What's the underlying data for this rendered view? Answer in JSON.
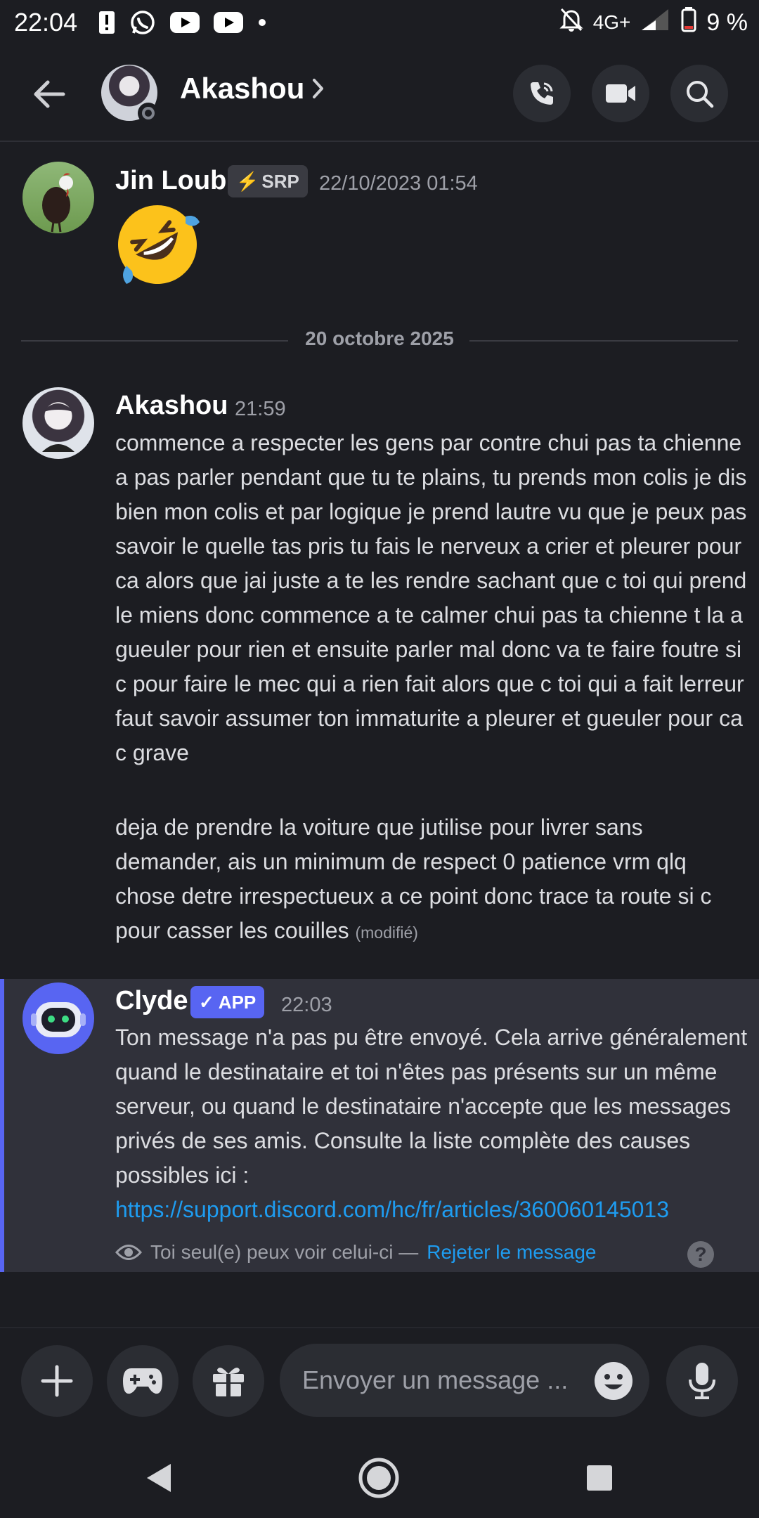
{
  "status_bar": {
    "time": "22:04",
    "network": "4G+",
    "battery": "9 %",
    "notification_icons": [
      "alert-icon",
      "whatsapp-icon",
      "youtube-icon",
      "youtube-icon",
      "dot-icon"
    ]
  },
  "header": {
    "contact_name": "Akashou"
  },
  "messages": [
    {
      "author": "Jin Loub",
      "tag": "SRP",
      "timestamp": "22/10/2023 01:54",
      "content": "🤣"
    },
    {
      "date_divider": "20 octobre 2025"
    },
    {
      "author": "Akashou",
      "timestamp": "21:59",
      "paragraph_1": "commence a respecter les gens par contre chui pas ta chienne a pas parler pendant que tu te plains, tu prends mon colis je dis bien mon colis et par logique je prend lautre vu que je peux pas savoir le quelle tas pris tu fais le nerveux a crier et pleurer pour ca alors que jai juste a te les rendre sachant que c toi qui prend le miens donc commence a te calmer chui pas ta chienne t la a gueuler pour rien et ensuite parler mal donc va te faire foutre si c pour faire le mec qui a rien fait alors que c toi qui a fait lerreur faut savoir assumer ton immaturite a pleurer et gueuler pour ca c grave",
      "paragraph_2": "deja de prendre la voiture que jutilise pour livrer sans demander, ais un minimum de respect 0 patience vrm qlq chose detre irrespectueux a ce point donc trace ta route si c pour casser les couilles",
      "edited_label": "(modifié)"
    },
    {
      "author": "Clyde",
      "tag": "APP",
      "timestamp": "22:03",
      "content": "Ton message n'a pas pu être envoyé. Cela arrive généralement quand le destinataire et toi n'êtes pas présents sur un même serveur, ou quand le destinataire n'accepte que les messages privés de ses amis. Consulte la liste complète des causes possibles ici :",
      "link": "https://support.discord.com/hc/fr/articles/360060145013",
      "visibility_note": "Toi seul(e) peux voir celui-ci —",
      "dismiss_label": "Rejeter le message",
      "help_label": "?"
    }
  ],
  "composer": {
    "placeholder": "Envoyer un message ..."
  },
  "colors": {
    "background": "#1c1d22",
    "accent": "#5865f2",
    "link": "#1e9cf0",
    "ephemeral_bg": "#30313a"
  }
}
